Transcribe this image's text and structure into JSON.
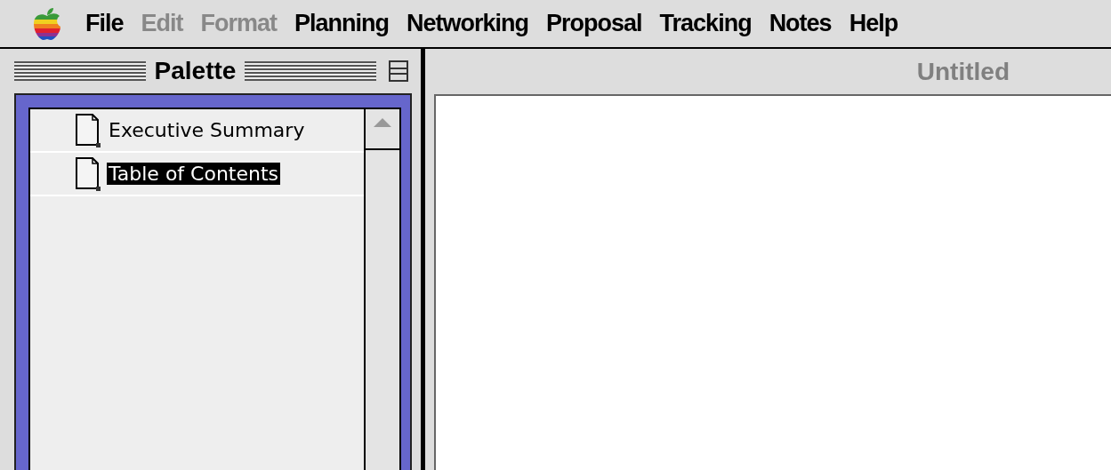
{
  "menu_bar": {
    "items": [
      {
        "label": "File",
        "disabled": false
      },
      {
        "label": "Edit",
        "disabled": true
      },
      {
        "label": "Format",
        "disabled": true
      },
      {
        "label": "Planning",
        "disabled": false
      },
      {
        "label": "Networking",
        "disabled": false
      },
      {
        "label": "Proposal",
        "disabled": false
      },
      {
        "label": "Tracking",
        "disabled": false
      },
      {
        "label": "Notes",
        "disabled": false
      },
      {
        "label": "Help",
        "disabled": false
      }
    ]
  },
  "palette": {
    "title": "Palette",
    "items": [
      {
        "label": "Executive Summary",
        "selected": false
      },
      {
        "label": "Table of Contents",
        "selected": true
      }
    ]
  },
  "document": {
    "title": "Untitled"
  }
}
